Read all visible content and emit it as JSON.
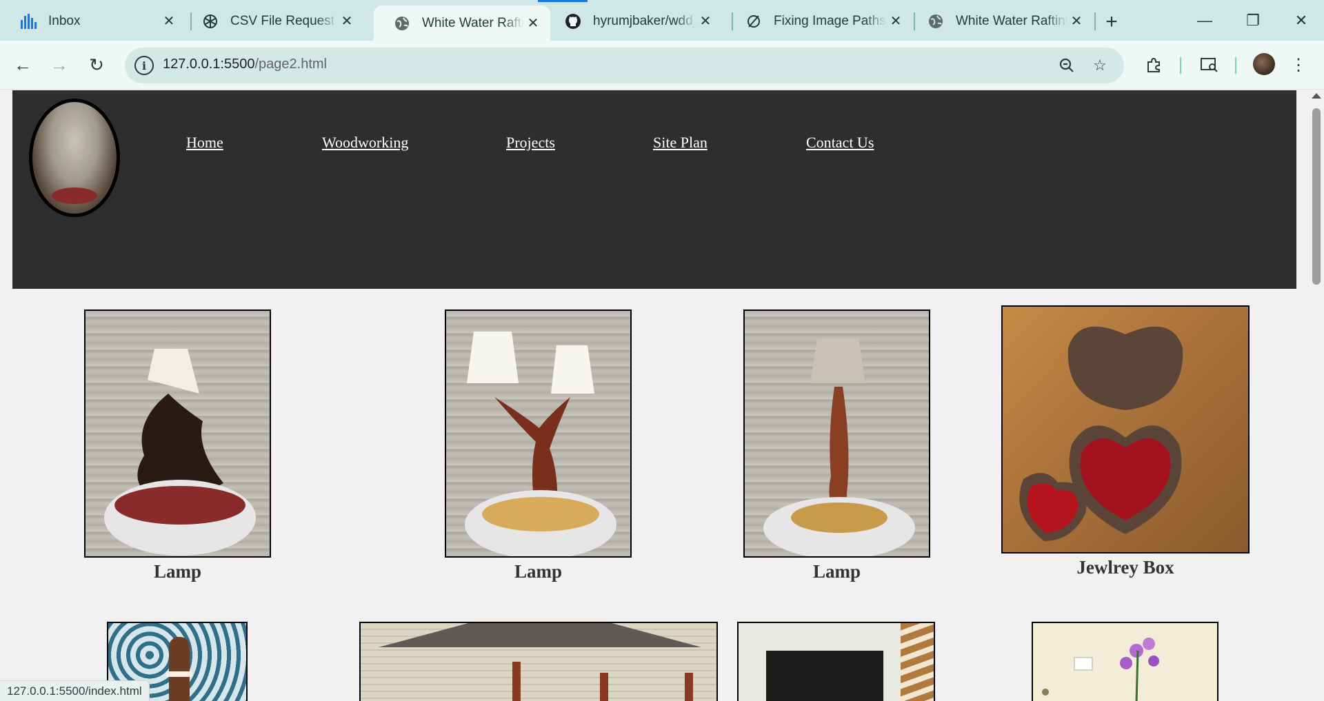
{
  "browser": {
    "tabs": [
      {
        "title": "Inbox",
        "icon": "bars-icon",
        "active": false
      },
      {
        "title": "CSV File Request",
        "icon": "openai-icon",
        "active": false
      },
      {
        "title": "White Water Rafting",
        "icon": "globe-icon",
        "active": true
      },
      {
        "title": "hyrumjbaker/wdd_1",
        "icon": "github-icon",
        "active": false
      },
      {
        "title": "Fixing Image Paths",
        "icon": "slash-circle-icon",
        "active": false
      },
      {
        "title": "White Water Rafting",
        "icon": "globe-icon",
        "active": false
      }
    ],
    "close_glyph": "✕",
    "new_tab_glyph": "+",
    "window": {
      "minimize": "—",
      "restore": "❐",
      "close": "✕"
    },
    "nav": {
      "back": "←",
      "forward": "→",
      "reload": "↻"
    },
    "url": {
      "host": "127.0.0.1:5500",
      "path": "/page2.html"
    },
    "status_url": "127.0.0.1:5500/index.html"
  },
  "site": {
    "nav": [
      {
        "label": "Home"
      },
      {
        "label": "Woodworking"
      },
      {
        "label": "Projects"
      },
      {
        "label": "Site Plan"
      },
      {
        "label": "Contact Us"
      }
    ],
    "products": [
      {
        "caption": "Lamp"
      },
      {
        "caption": "Lamp"
      },
      {
        "caption": "Lamp"
      },
      {
        "caption": "Jewlrey Box"
      }
    ]
  },
  "colors": {
    "tabstrip": "#cfe8e5",
    "toolbar": "#f0f8f6",
    "header": "#2e2e2e",
    "page_bg": "#f1f1f1"
  }
}
